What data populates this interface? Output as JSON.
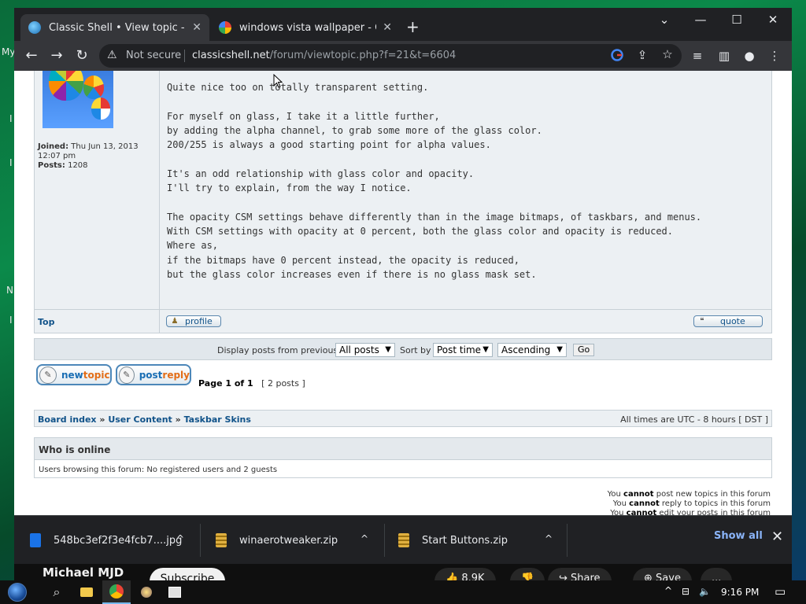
{
  "desktop": {
    "left_texts": [
      "My",
      "I",
      "I",
      "N",
      "I"
    ]
  },
  "browser": {
    "tabs": [
      {
        "title": "Classic Shell • View topic - Origin",
        "close": "✕",
        "active": true
      },
      {
        "title": "windows vista wallpaper - Googl",
        "close": "✕",
        "active": false
      }
    ],
    "new_tab": "+",
    "window_controls": {
      "list": "⌄",
      "minimize": "—",
      "maximize": "☐",
      "close": "✕"
    },
    "nav": {
      "back": "←",
      "forward": "→",
      "reload": "↻"
    },
    "address": {
      "security_icon": "⚠",
      "security_label": "Not secure",
      "domain": "classicshell.net",
      "path": "/forum/viewtopic.php?f=21&t=6604"
    },
    "toolbar_icons": [
      "google-lens-icon",
      "share-icon",
      "bookmark-star-icon",
      "media-queue-icon",
      "side-panel-icon",
      "profile-icon",
      "menu-icon"
    ]
  },
  "post": {
    "profile": {
      "joined_label": "Joined:",
      "joined_value": "Thu Jun 13, 2013 12:07 pm",
      "posts_label": "Posts:",
      "posts_value": "1208"
    },
    "paragraphs": [
      [
        "Quite nice too on totally transparent setting."
      ],
      [
        "For myself on glass, I take it a little further,",
        "by adding the alpha channel, to grab some more of the glass color.",
        "200/255 is always a good starting point for alpha values."
      ],
      [
        "It's an odd relationship with glass color and opacity.",
        "I'll try to explain, from the way I notice."
      ],
      [
        "The opacity CSM settings behave differently than in the image bitmaps, of taskbars, and menus.",
        "With CSM settings with opacity at 0 percent, both the glass color and opacity is reduced.",
        "Where as,",
        "if the bitmaps have 0 percent instead, the opacity is reduced,",
        "but the glass color increases even if there is no glass mask set."
      ]
    ],
    "top_link": "Top",
    "profile_button": "profile",
    "quote_button": "quote"
  },
  "sort": {
    "display_label": "Display posts from previous:",
    "posts_value": "All posts",
    "sort_by_label": "Sort by",
    "sort_value": "Post time",
    "order_value": "Ascending",
    "go_label": "Go"
  },
  "actions": {
    "newtopic": {
      "w1": "new",
      "w2": "topic"
    },
    "postreply": {
      "w1": "post",
      "w2": "reply"
    }
  },
  "pagination": {
    "page_text": "Page 1 of 1",
    "posts_text": "[ 2 posts ]"
  },
  "breadcrumb": {
    "items": [
      "Board index",
      "User Content",
      "Taskbar Skins"
    ],
    "separator": "»",
    "timezone": "All times are UTC - 8 hours [ DST ]"
  },
  "who_online": {
    "heading": "Who is online",
    "text": "Users browsing this forum: No registered users and 2 guests"
  },
  "permissions": [
    {
      "pre": "You ",
      "bold": "cannot",
      "post": " post new topics in this forum"
    },
    {
      "pre": "You ",
      "bold": "cannot",
      "post": " reply to topics in this forum"
    },
    {
      "pre": "You ",
      "bold": "cannot",
      "post": " edit your posts in this forum"
    }
  ],
  "downloads": {
    "items": [
      {
        "name": "548bc3ef2f3e4fcb7....jpg"
      },
      {
        "name": "winaerotweaker.zip"
      },
      {
        "name": "Start Buttons.zip"
      }
    ],
    "show_all": "Show all",
    "close": "✕",
    "chevron": "^"
  },
  "youtube": {
    "channel": "Michael MJD",
    "subscribe": "Subscribe",
    "likes": "8.9K",
    "share": "Share",
    "save": "Save",
    "more": "..."
  },
  "taskbar": {
    "clock": "9:16 PM",
    "tray_icons": [
      "^",
      "network-icon",
      "volume-icon"
    ]
  },
  "colors": {
    "link": "#105289",
    "forum_bg": "#ecf0f3",
    "border": "#c7d0d6",
    "chrome_dark": "#202124",
    "chrome_toolbar": "#35363a"
  }
}
